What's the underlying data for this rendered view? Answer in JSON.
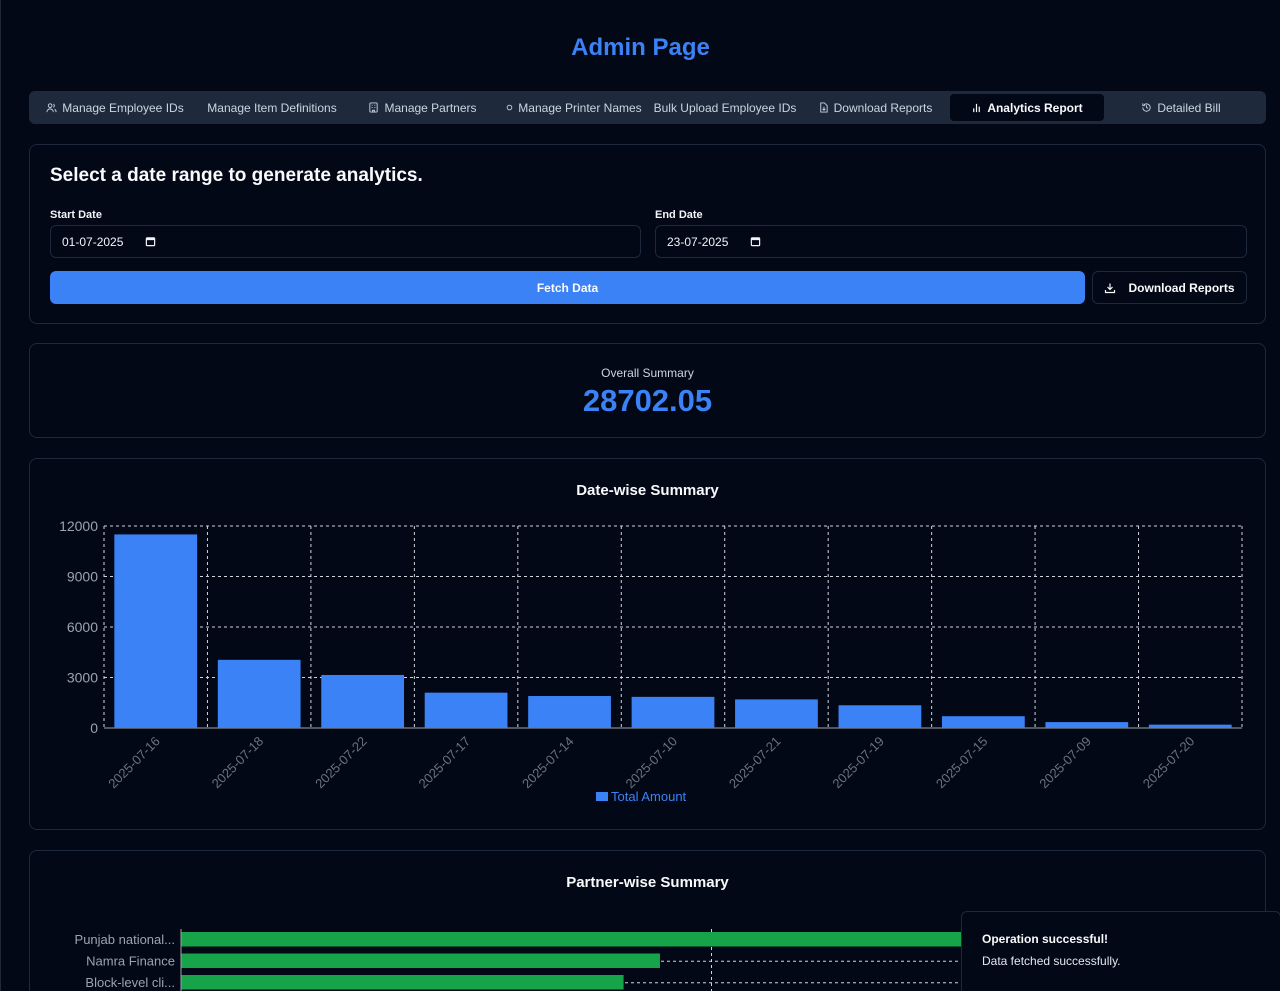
{
  "page": {
    "title": "Admin Page"
  },
  "tabs": [
    {
      "label": "Manage Employee IDs",
      "icon": "users-icon",
      "active": false
    },
    {
      "label": "Manage Item Definitions",
      "icon": "",
      "active": false
    },
    {
      "label": "Manage Partners",
      "icon": "building-icon",
      "active": false
    },
    {
      "label": "Manage Printer Names",
      "icon": "dot-icon",
      "active": false
    },
    {
      "label": "Bulk Upload Employee IDs",
      "icon": "",
      "active": false
    },
    {
      "label": "Download Reports",
      "icon": "file-download-icon",
      "active": false
    },
    {
      "label": "Analytics Report",
      "icon": "bar-chart-icon",
      "active": true
    },
    {
      "label": "Detailed Bill",
      "icon": "history-icon",
      "active": false
    }
  ],
  "range": {
    "heading": "Select a date range to generate analytics.",
    "start_label": "Start Date",
    "start_value": "01-07-2025",
    "end_label": "End Date",
    "end_value": "23-07-2025",
    "fetch_label": "Fetch Data",
    "download_label": "Download Reports"
  },
  "summary": {
    "label": "Overall Summary",
    "value": "28702.05"
  },
  "chart_data": [
    {
      "type": "bar",
      "title": "Date-wise Summary",
      "categories": [
        "2025-07-16",
        "2025-07-18",
        "2025-07-22",
        "2025-07-17",
        "2025-07-14",
        "2025-07-10",
        "2025-07-21",
        "2025-07-19",
        "2025-07-15",
        "2025-07-09",
        "2025-07-20"
      ],
      "series": [
        {
          "name": "Total Amount",
          "values": [
            11500,
            4050,
            3150,
            2100,
            1900,
            1850,
            1700,
            1350,
            700,
            350,
            200
          ]
        }
      ],
      "ylim": [
        0,
        12000
      ],
      "yticks": [
        0,
        3000,
        6000,
        9000,
        12000
      ],
      "grid": true,
      "legend": "bottom",
      "color": "#3b82f6"
    },
    {
      "type": "bar",
      "orientation": "horizontal",
      "title": "Partner-wise Summary",
      "categories": [
        "Punjab national...",
        "Namra Finance",
        "Block-level cli..."
      ],
      "values": [
        16500,
        7900,
        7300
      ],
      "grid": true,
      "color": "#16a34a"
    }
  ],
  "toast": {
    "title": "Operation successful!",
    "message": "Data fetched successfully."
  }
}
